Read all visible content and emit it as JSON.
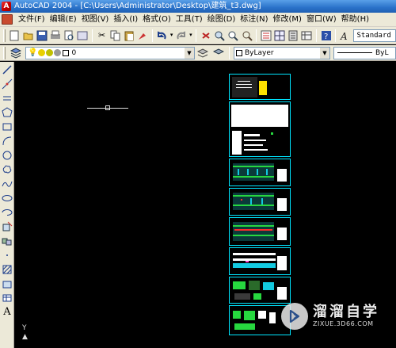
{
  "window": {
    "title": "AutoCAD 2004 - [C:\\Users\\Administrator\\Desktop\\建筑_t3.dwg]",
    "logo_letter": "A"
  },
  "menu": {
    "items": [
      "文件(F)",
      "编辑(E)",
      "视图(V)",
      "插入(I)",
      "格式(O)",
      "工具(T)",
      "绘图(D)",
      "标注(N)",
      "修改(M)",
      "窗口(W)",
      "帮助(H)"
    ]
  },
  "toolbar": {
    "text_style": "Standard",
    "layer_name": "0",
    "color": "ByLayer",
    "linetype": "ByL"
  },
  "ucs": {
    "y_label": "Y"
  },
  "watermark": {
    "title": "溜溜自学",
    "url": "ZIXUE.3D66.COM"
  },
  "colors": {
    "canvas": "#000000",
    "sheet_border": "#00e5ff",
    "titlebar": "#2a72c9"
  }
}
